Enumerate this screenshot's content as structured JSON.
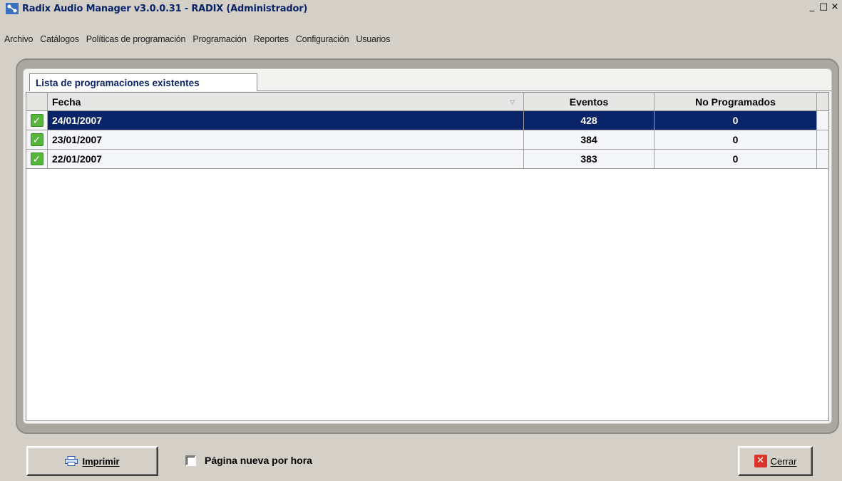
{
  "window": {
    "title": "Radix Audio Manager v3.0.0.31 - RADIX (Administrador)",
    "minimize_glyph": "_",
    "maximize_glyph": "□",
    "close_glyph": "×"
  },
  "menu": {
    "items": [
      {
        "label": "Archivo"
      },
      {
        "label": "Catálogos"
      },
      {
        "label": "Políticas de programación"
      },
      {
        "label": "Programación"
      },
      {
        "label": "Reportes"
      },
      {
        "label": "Configuración"
      },
      {
        "label": "Usuarios"
      }
    ]
  },
  "tab": {
    "label": "Lista de programaciones existentes"
  },
  "grid": {
    "columns": {
      "fecha": "Fecha",
      "eventos": "Eventos",
      "no_programados": "No Programados"
    },
    "rows": [
      {
        "fecha": "24/01/2007",
        "eventos": "428",
        "no_programados": "0",
        "selected": true,
        "status_icon": "check-icon"
      },
      {
        "fecha": "23/01/2007",
        "eventos": "384",
        "no_programados": "0",
        "selected": false,
        "status_icon": "check-icon"
      },
      {
        "fecha": "22/01/2007",
        "eventos": "383",
        "no_programados": "0",
        "selected": false,
        "status_icon": "check-icon"
      }
    ]
  },
  "footer": {
    "print_label": "Imprimir",
    "checkbox_label": "Página nueva por hora",
    "checkbox_checked": false,
    "close_label": "Cerrar"
  },
  "colors": {
    "selection": "#0a246a",
    "title_text": "#0a246a",
    "check": "#56b53a",
    "close_icon": "#d9352a"
  }
}
